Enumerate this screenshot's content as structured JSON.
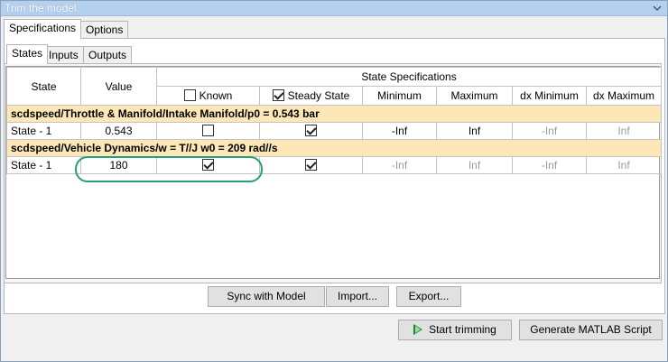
{
  "window": {
    "title": "Trim the model"
  },
  "outer_tabs": [
    "Specifications",
    "Options"
  ],
  "inner_tabs": [
    "States",
    "Inputs",
    "Outputs"
  ],
  "table": {
    "group_header": "State Specifications",
    "columns": {
      "state": "State",
      "value": "Value",
      "known": "Known",
      "steady_state": "Steady State",
      "minimum": "Minimum",
      "maximum": "Maximum",
      "dx_minimum": "dx Minimum",
      "dx_maximum": "dx Maximum"
    },
    "header_checks": {
      "known": false,
      "steady_state": true
    },
    "groups": [
      {
        "title": "scdspeed/Throttle & Manifold/Intake Manifold/p0 = 0.543 bar",
        "row": {
          "state": "State - 1",
          "value": "0.543",
          "known": false,
          "steady_state": true,
          "minimum": "-Inf",
          "maximum": "Inf",
          "dx_minimum": "-Inf",
          "dx_maximum": "Inf"
        }
      },
      {
        "title": "scdspeed/Vehicle Dynamics/w = T//J w0 = 209 rad//s",
        "row": {
          "state": "State - 1",
          "value": "180",
          "known": true,
          "steady_state": true,
          "minimum": "-Inf",
          "maximum": "Inf",
          "dx_minimum": "-Inf",
          "dx_maximum": "Inf"
        }
      }
    ]
  },
  "buttons": {
    "sync": "Sync with Model",
    "import": "Import...",
    "export": "Export...",
    "start_trimming": "Start trimming",
    "generate_script": "Generate MATLAB Script"
  },
  "colors": {
    "title_bar": "#b3d0ee",
    "group_row": "#fde7b7",
    "highlight": "#2a9d7f",
    "play": "#1b8a2e"
  }
}
